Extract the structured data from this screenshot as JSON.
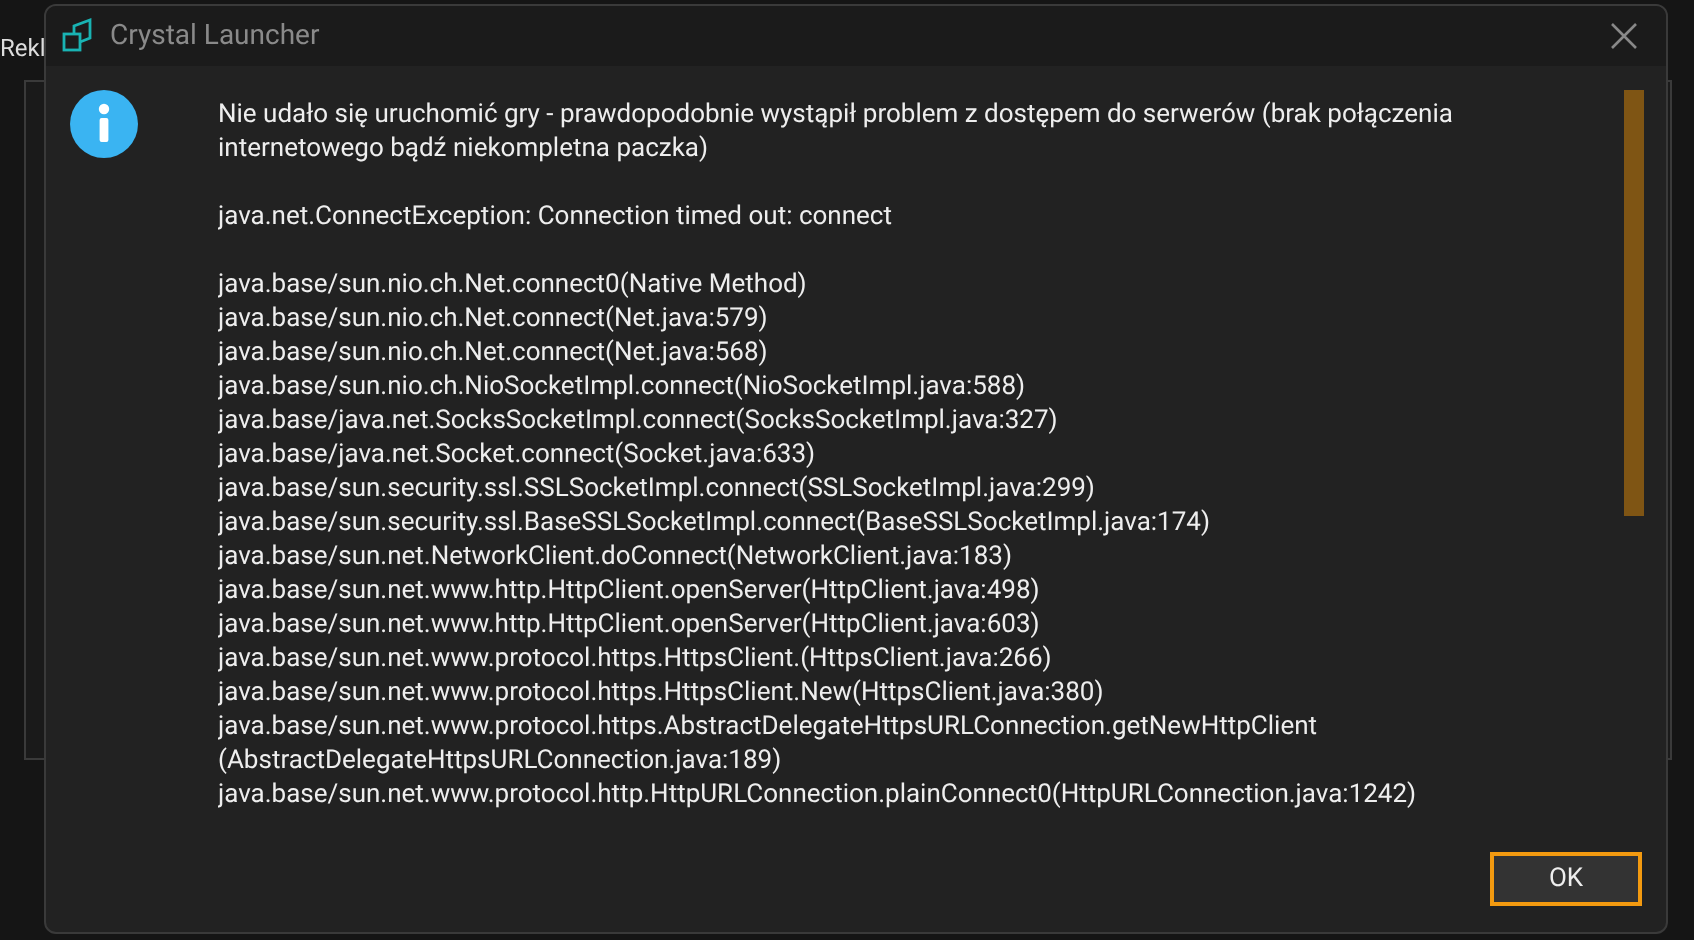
{
  "background": {
    "label": "Rekl"
  },
  "dialog": {
    "title": "Crystal Launcher",
    "message": "Nie udało się uruchomić gry - prawdopodobnie wystąpił problem z dostępem do serwerów (brak połączenia internetowego bądź niekompletna paczka)",
    "exception": "java.net.ConnectException: Connection timed out: connect",
    "stack": [
      "java.base/sun.nio.ch.Net.connect0(Native Method)",
      "java.base/sun.nio.ch.Net.connect(Net.java:579)",
      "java.base/sun.nio.ch.Net.connect(Net.java:568)",
      "java.base/sun.nio.ch.NioSocketImpl.connect(NioSocketImpl.java:588)",
      "java.base/java.net.SocksSocketImpl.connect(SocksSocketImpl.java:327)",
      "java.base/java.net.Socket.connect(Socket.java:633)",
      "java.base/sun.security.ssl.SSLSocketImpl.connect(SSLSocketImpl.java:299)",
      "java.base/sun.security.ssl.BaseSSLSocketImpl.connect(BaseSSLSocketImpl.java:174)",
      "java.base/sun.net.NetworkClient.doConnect(NetworkClient.java:183)",
      "java.base/sun.net.www.http.HttpClient.openServer(HttpClient.java:498)",
      "java.base/sun.net.www.http.HttpClient.openServer(HttpClient.java:603)",
      "java.base/sun.net.www.protocol.https.HttpsClient.(HttpsClient.java:266)",
      "java.base/sun.net.www.protocol.https.HttpsClient.New(HttpsClient.java:380)",
      "java.base/sun.net.www.protocol.https.AbstractDelegateHttpsURLConnection.getNewHttpClient (AbstractDelegateHttpsURLConnection.java:189)",
      "java.base/sun.net.www.protocol.http.HttpURLConnection.plainConnect0(HttpURLConnection.java:1242)"
    ],
    "buttons": [
      "OK"
    ]
  }
}
